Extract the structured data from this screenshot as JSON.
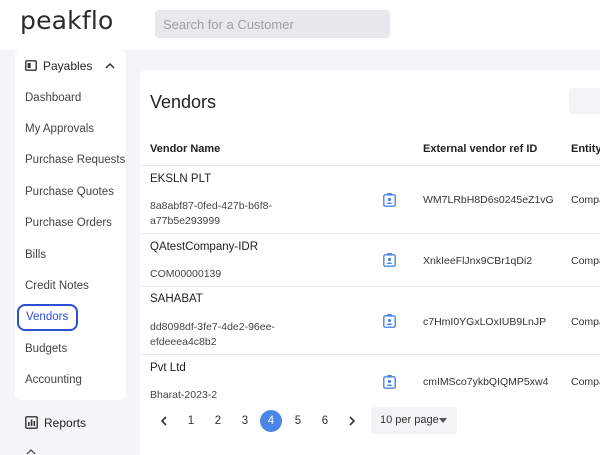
{
  "app": {
    "logo": "peakflo"
  },
  "search": {
    "placeholder": "Search for a Customer"
  },
  "sidebar": {
    "group_label": "Payables",
    "items": [
      {
        "label": "Dashboard"
      },
      {
        "label": "My Approvals"
      },
      {
        "label": "Purchase Requests"
      },
      {
        "label": "Purchase Quotes"
      },
      {
        "label": "Purchase Orders"
      },
      {
        "label": "Bills"
      },
      {
        "label": "Credit Notes"
      },
      {
        "label": "Vendors",
        "active": true
      },
      {
        "label": "Budgets"
      },
      {
        "label": "Accounting"
      }
    ],
    "reports_label": "Reports"
  },
  "main": {
    "title": "Vendors",
    "columns": [
      "Vendor Name",
      "External vendor ref ID",
      "Entity"
    ],
    "rows": [
      {
        "name": "EKSLN PLT",
        "id_line1": "8a8abf87-0fed-427b-b6f8-",
        "id_line2": "a77b5e293999",
        "ext_ref": "WM7LRbH8D6s0245eZ1vG",
        "entity": "Compa"
      },
      {
        "name": "QAtestCompany-IDR",
        "id_line1": "COM00000139",
        "id_line2": "",
        "ext_ref": "XnkIeeFlJnx9CBr1qDi2",
        "entity": "Compa"
      },
      {
        "name": "SAHABAT",
        "id_line1": "dd8098df-3fe7-4de2-96ee-",
        "id_line2": "efdeeea4c8b2",
        "ext_ref": "c7HmI0YGxLOxIUB9LnJP",
        "entity": "Compa"
      },
      {
        "name": "Pvt Ltd",
        "id_line1": "Bharat-2023-2",
        "id_line2": "",
        "ext_ref": "cmIMSco7ykbQIQMP5xw4",
        "entity": "Compa"
      }
    ]
  },
  "pagination": {
    "pages": [
      "1",
      "2",
      "3",
      "4",
      "5",
      "6"
    ],
    "current": 4,
    "per_page_label": "10 per page"
  },
  "colors": {
    "accent": "#2b4fd8",
    "page_active": "#4a86e8",
    "vendor_icon": "#4a86e8"
  }
}
